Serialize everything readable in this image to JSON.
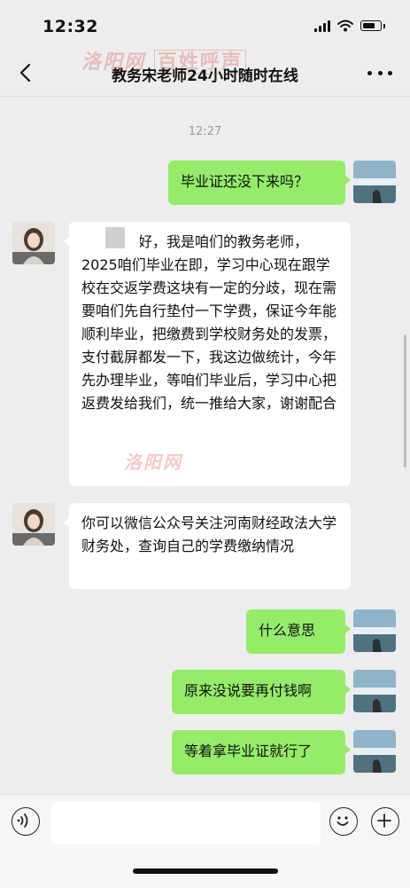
{
  "status_bar": {
    "time": "12:32"
  },
  "nav": {
    "title": "教务宋老师24小时随时在线"
  },
  "chat": {
    "timestamp": "12:27",
    "messages": [
      {
        "side": "right",
        "text": "毕业证还没下来吗？"
      },
      {
        "side": "left",
        "text": "同学，你好，我是咱们的教务老师，2025咱们毕业在即，学习中心现在跟学校在交返学费这块有一定的分歧，现在需要咱们先自行垫付一下学费，保证今年能顺利毕业，把缴费到学校财务处的发票，支付截屏都发一下，我这边做统计，今年先办理毕业，等咱们毕业后，学习中心把返费发给我们，统一推给大家，谢谢配合"
      },
      {
        "side": "left",
        "text": "你可以微信公众号关注河南财经政法大学财务处，查询自己的学费缴纳情况"
      },
      {
        "side": "right",
        "text": "什么意思"
      },
      {
        "side": "right",
        "text": "原来没说要再付钱啊"
      },
      {
        "side": "right",
        "text": "等着拿毕业证就行了"
      }
    ]
  },
  "input": {
    "placeholder": ""
  },
  "watermarks": {
    "site": "洛阳网",
    "brand": "百姓呼声"
  },
  "colors": {
    "background": "#ededed",
    "outgoing_bubble": "#95ec69",
    "incoming_bubble": "#ffffff"
  },
  "icons": [
    "back-arrow-icon",
    "more-dots-icon",
    "voice-icon",
    "emoji-icon",
    "plus-icon",
    "signal-icon",
    "wifi-icon",
    "battery-icon"
  ]
}
